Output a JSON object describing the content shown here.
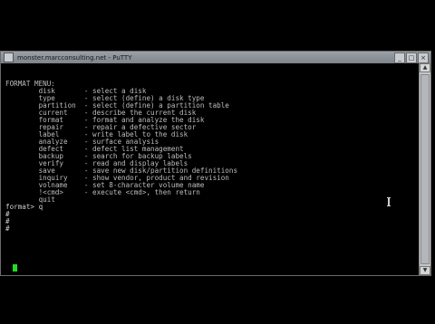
{
  "window": {
    "title": "monster.marcconsulting.net - PuTTY",
    "icon": "putty-icon",
    "controls": {
      "minimize": "_",
      "maximize": "□",
      "close": "×"
    }
  },
  "terminal": {
    "lines": [
      "FORMAT MENU:",
      "        disk       - select a disk",
      "        type       - select (define) a disk type",
      "        partition  - select (define) a partition table",
      "        current    - describe the current disk",
      "        format     - format and analyze the disk",
      "        repair     - repair a defective sector",
      "        label      - write label to the disk",
      "        analyze    - surface analysis",
      "        defect     - defect list management",
      "        backup     - search for backup labels",
      "        verify     - read and display labels",
      "        save       - save new disk/partition definitions",
      "        inquiry    - show vendor, product and revision",
      "        volname    - set 8-character volume name",
      "        !<cmd>     - execute <cmd>, then return",
      "        quit",
      "format> q",
      "#",
      "#",
      "#"
    ]
  },
  "scrollbar": {
    "up": "▲",
    "down": "▼"
  }
}
